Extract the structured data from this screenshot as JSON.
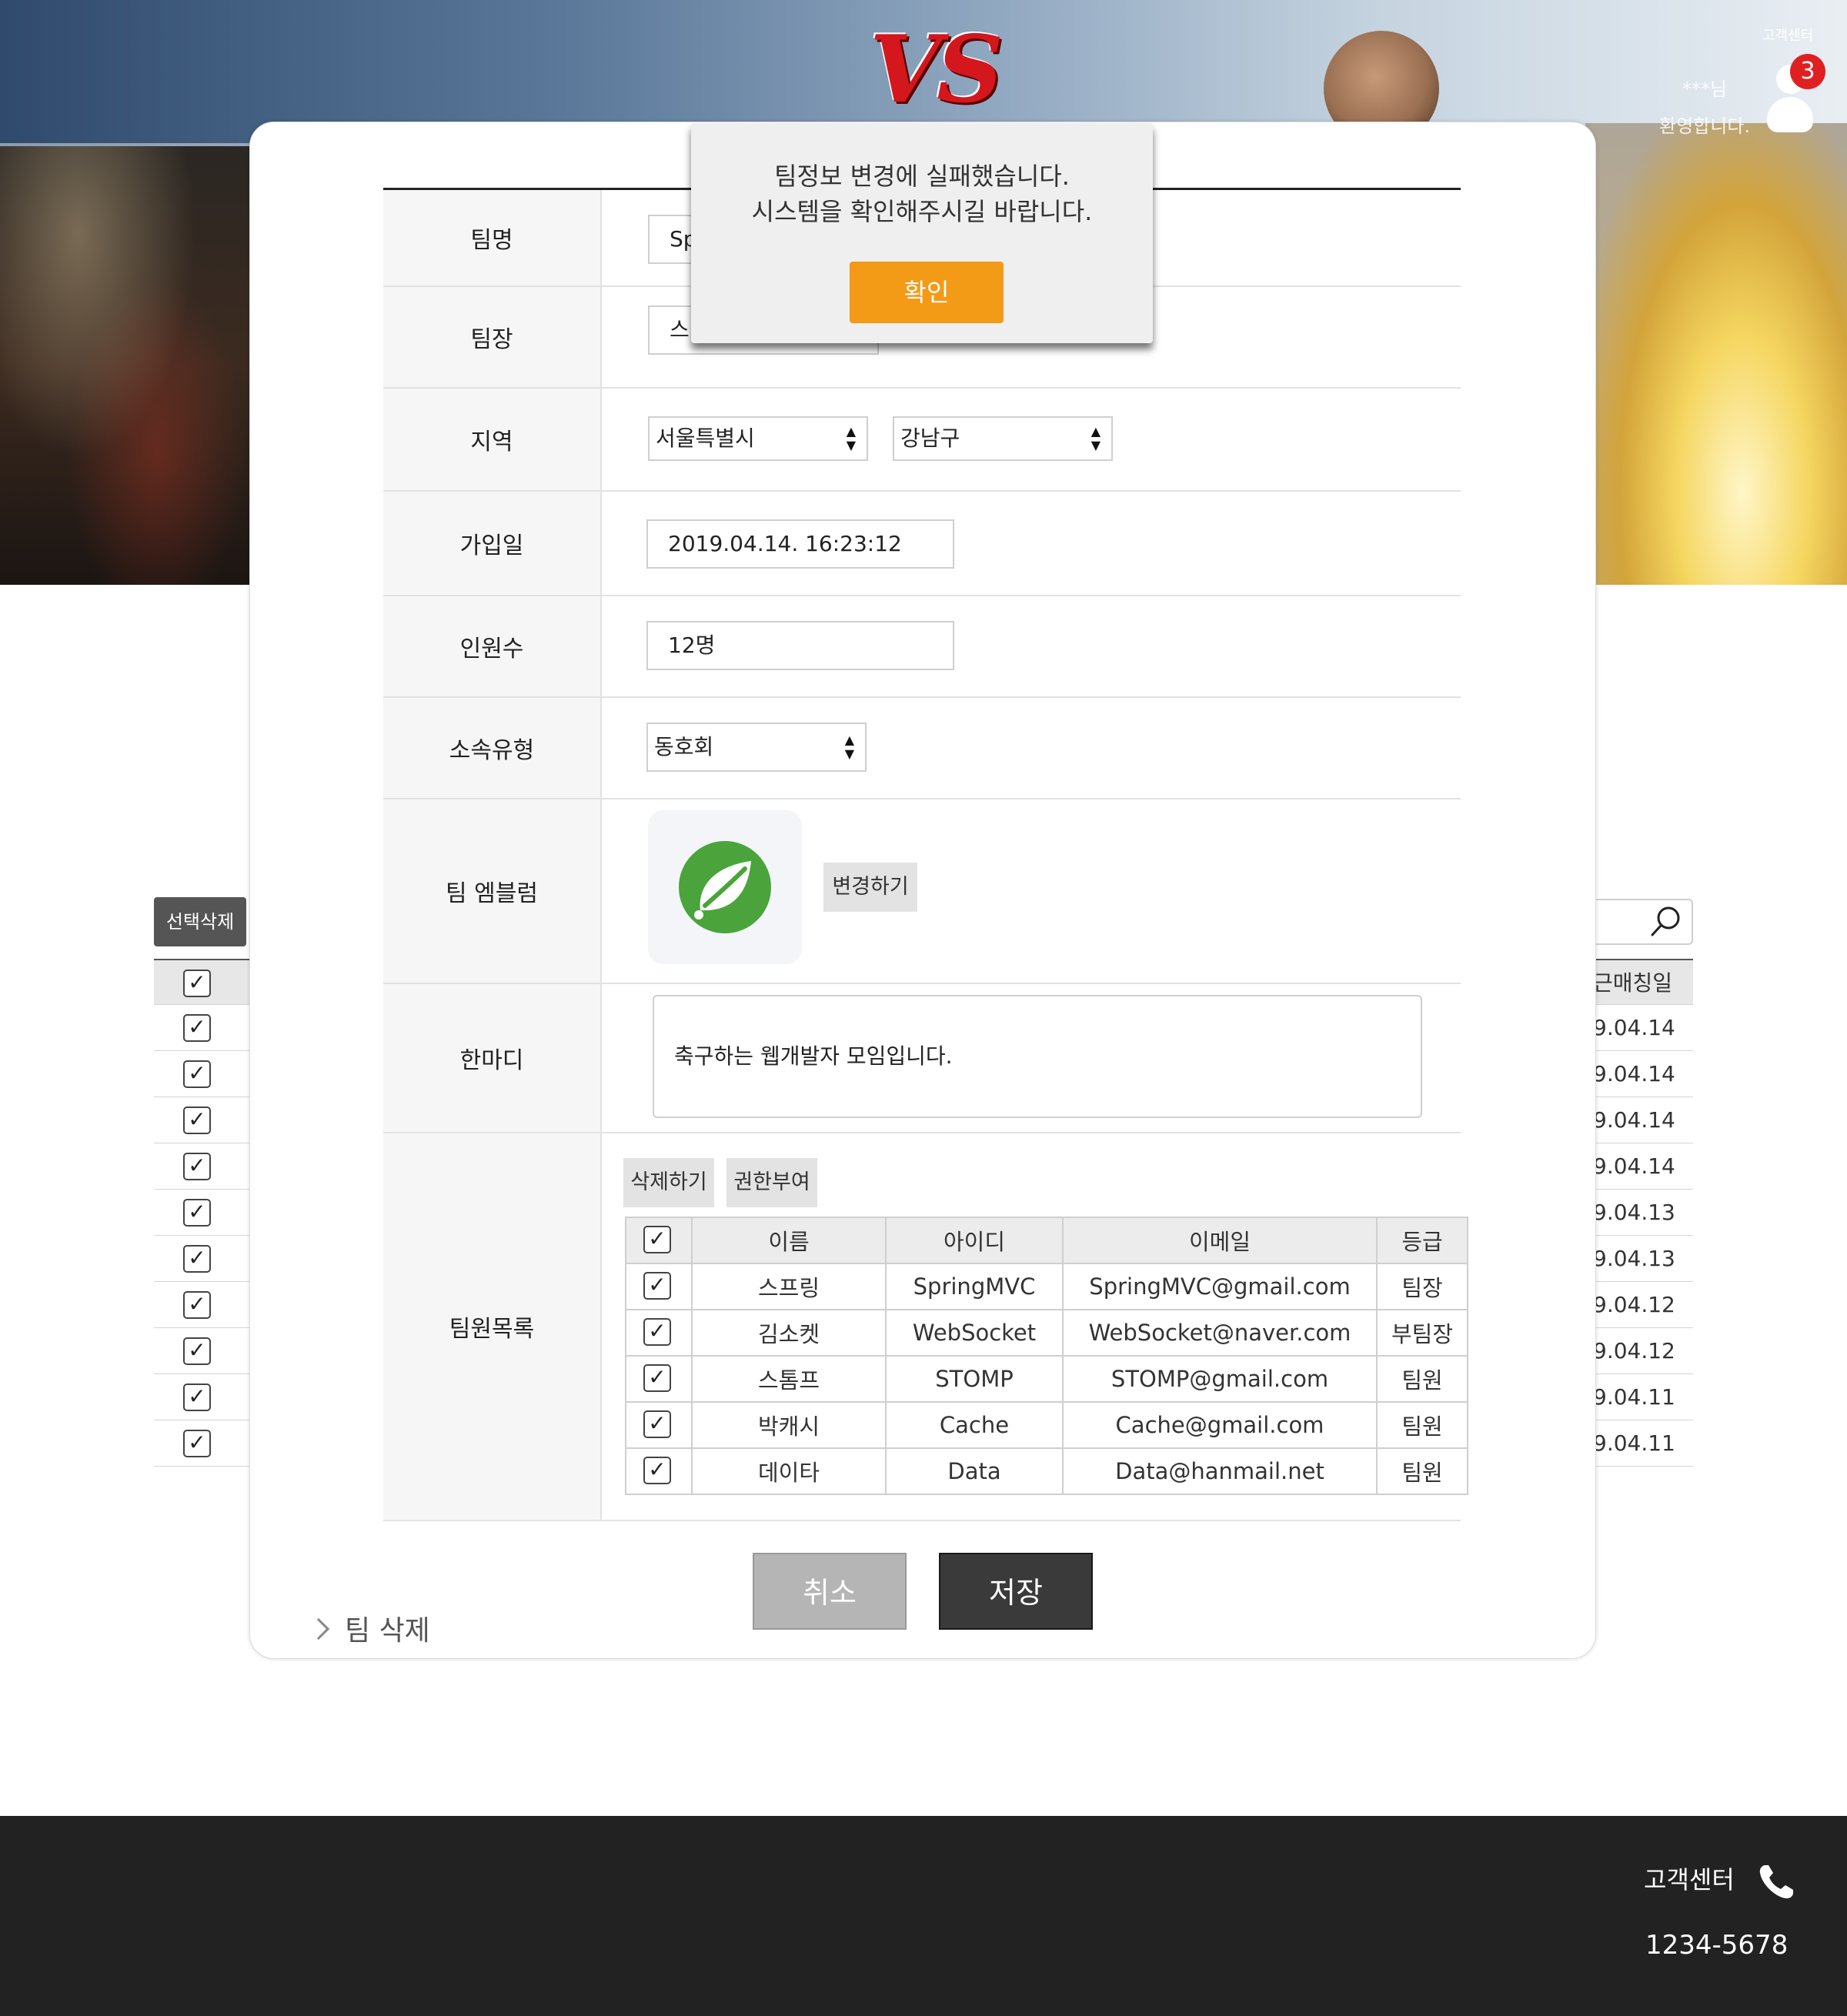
{
  "header": {
    "logo_text": "VS",
    "customer_center": "고객센터",
    "user_name": "***님",
    "welcome": "환영합니다.",
    "notification_count": "3"
  },
  "background_list": {
    "select_delete_label": "선택삭제",
    "date_header": "근매칭일",
    "dates": [
      "9.04.14",
      "9.04.14",
      "9.04.14",
      "9.04.14",
      "9.04.13",
      "9.04.13",
      "9.04.12",
      "9.04.12",
      "9.04.11",
      "9.04.11"
    ]
  },
  "form": {
    "labels": {
      "team_name": "팀명",
      "captain": "팀장",
      "region": "지역",
      "join_date": "가입일",
      "members": "인원수",
      "type": "소속유형",
      "emblem": "팀 엠블럼",
      "comment": "한마디",
      "member_list": "팀원목록"
    },
    "team_name_value": "Sp",
    "captain_value": "스",
    "region_city": "서울특별시",
    "region_district": "강남구",
    "join_date_value": "2019.04.14. 16:23:12",
    "members_value": "12명",
    "type_value": "동호회",
    "emblem_change": "변경하기",
    "comment_value": "축구하는 웹개발자 모임입니다.",
    "delete_btn": "삭제하기",
    "grant_btn": "권한부여",
    "table_headers": [
      "이름",
      "아이디",
      "이메일",
      "등급"
    ],
    "members_rows": [
      {
        "name": "스프링",
        "id": "SpringMVC",
        "email": "SpringMVC@gmail.com",
        "grade": "팀장"
      },
      {
        "name": "김소켓",
        "id": "WebSocket",
        "email": "WebSocket@naver.com",
        "grade": "부팀장"
      },
      {
        "name": "스톰프",
        "id": "STOMP",
        "email": "STOMP@gmail.com",
        "grade": "팀원"
      },
      {
        "name": "박캐시",
        "id": "Cache",
        "email": "Cache@gmail.com",
        "grade": "팀원"
      },
      {
        "name": "데이타",
        "id": "Data",
        "email": "Data@hanmail.net",
        "grade": "팀원"
      }
    ],
    "cancel": "취소",
    "save": "저장",
    "team_delete": "팀 삭제"
  },
  "alert": {
    "line1": "팀정보 변경에 실패했습니다.",
    "line2": "시스템을 확인해주시길 바랍니다.",
    "ok": "확인"
  },
  "footer": {
    "customer_center": "고객센터",
    "phone": "1234-5678"
  },
  "colors": {
    "accent": "#f39a16",
    "badge": "#e02020",
    "footer_bg": "#222222"
  }
}
